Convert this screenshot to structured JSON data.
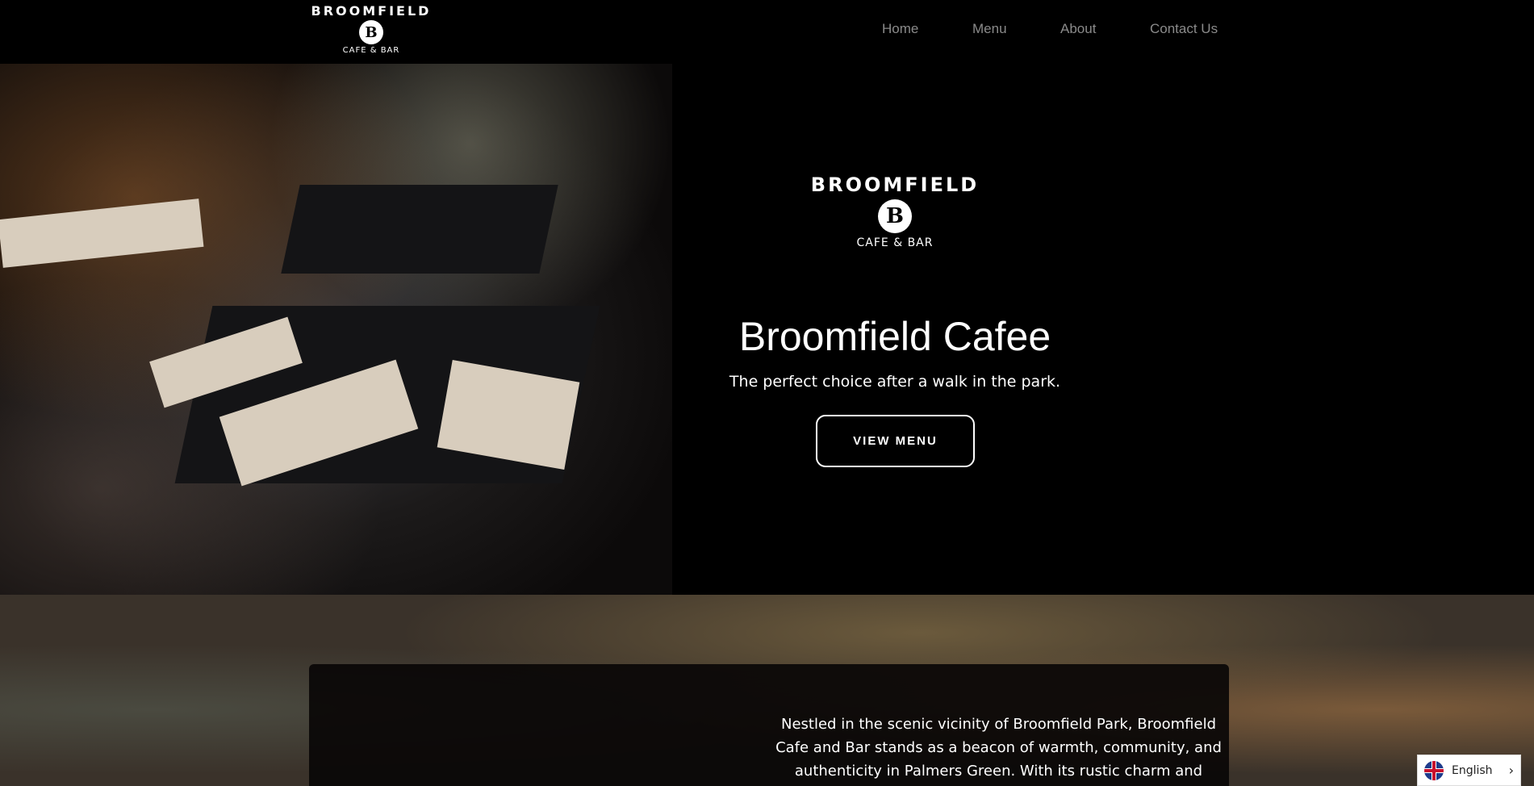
{
  "header": {
    "logo": {
      "name": "BROOMFIELD",
      "initial": "B",
      "tagline": "CAFE & BAR"
    },
    "nav": [
      {
        "label": "Home"
      },
      {
        "label": "Menu"
      },
      {
        "label": "About"
      },
      {
        "label": "Contact Us"
      }
    ]
  },
  "hero": {
    "logo": {
      "name": "BROOMFIELD",
      "initial": "B",
      "tagline": "CAFE & BAR"
    },
    "title": "Broomfield Cafee",
    "subtitle": "The perfect choice after a walk in the park.",
    "button": "VIEW MENU"
  },
  "about": {
    "lines": [
      "Nestled in the scenic vicinity of Broomfield Park, Broomfield",
      "Cafe and Bar stands as a beacon of warmth, community, and",
      "authenticity in Palmers Green. With its rustic charm and"
    ]
  },
  "language": {
    "label": "English"
  }
}
